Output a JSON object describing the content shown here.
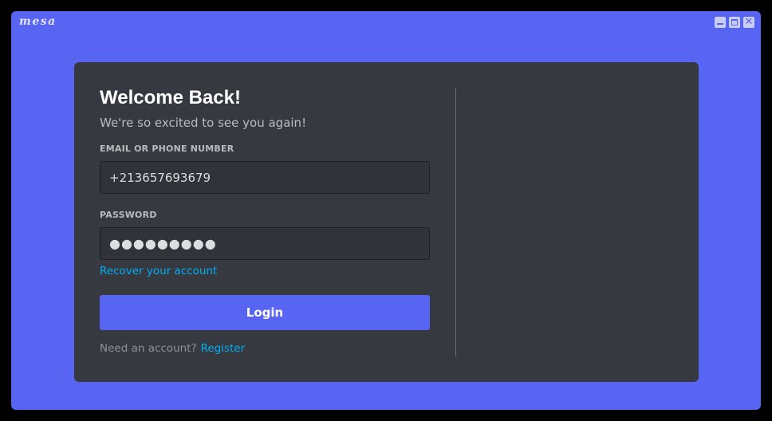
{
  "app": {
    "logo_text": "mesa"
  },
  "window_controls": {
    "minimize_icon": "minimize-icon",
    "maximize_icon": "maximize-icon",
    "close_icon": "close-icon",
    "close_glyph": "✕"
  },
  "login": {
    "title": "Welcome Back!",
    "subtitle": "We're so excited to see you again!",
    "email_label": "EMAIL OR PHONE NUMBER",
    "email_value": "+213657693679",
    "password_label": "PASSWORD",
    "password_value": "●●●●●●●●●",
    "recover_link": "Recover your account",
    "login_button": "Login",
    "register_prompt": "Need an account?",
    "register_link": "Register"
  },
  "colors": {
    "window_background": "#5865f2",
    "card_background": "#36393f",
    "input_background": "#303339",
    "accent": "#5865f2",
    "link": "#00aff4",
    "heading_text": "#ffffff",
    "muted_text": "#b9bbbe"
  }
}
